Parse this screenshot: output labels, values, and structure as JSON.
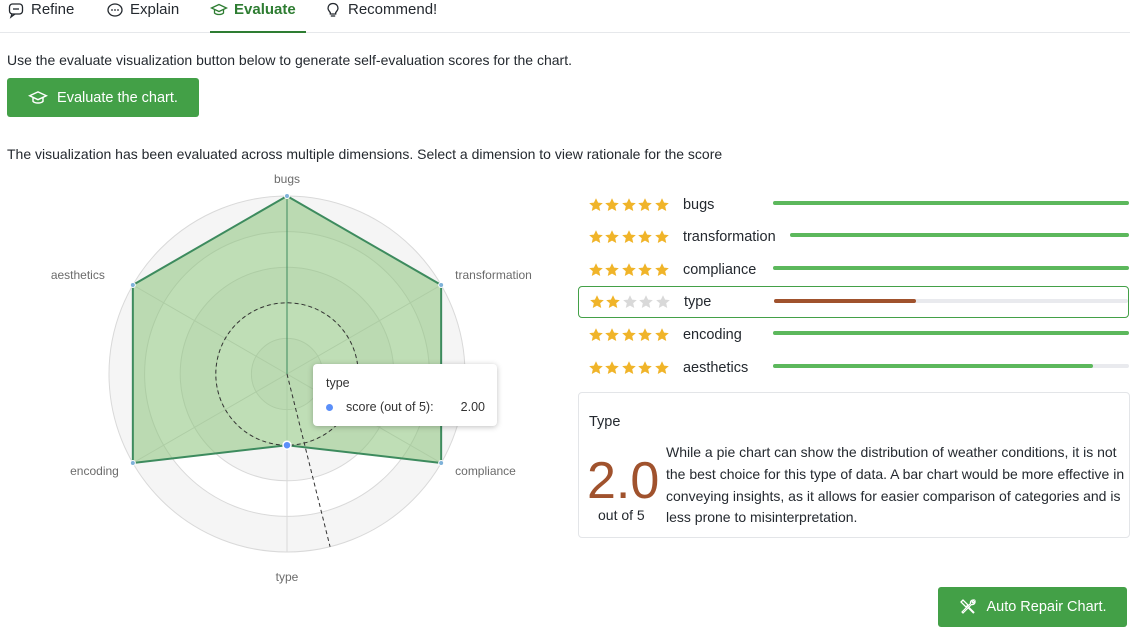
{
  "tabs": [
    {
      "label": "Refine",
      "icon": "chat-bubble-icon"
    },
    {
      "label": "Explain",
      "icon": "chat-dots-icon"
    },
    {
      "label": "Evaluate",
      "icon": "graduation-cap-icon",
      "active": true
    },
    {
      "label": "Recommend!",
      "icon": "lightbulb-icon"
    }
  ],
  "intro_text": "Use the evaluate visualization button below to generate self-evaluation scores for the chart.",
  "evaluate_button": {
    "label": "Evaluate the chart.",
    "icon": "graduation-cap-icon"
  },
  "description": "The visualization has been evaluated across multiple dimensions. Select a dimension to view rationale for the score",
  "chart_data": {
    "type": "radar",
    "categories": [
      "bugs",
      "transformation",
      "compliance",
      "type",
      "encoding",
      "aesthetics"
    ],
    "values": [
      5,
      5,
      5,
      2,
      5,
      5
    ],
    "rlim": [
      0,
      5
    ],
    "grid": true
  },
  "tooltip": {
    "title": "type",
    "key": "score (out of 5):",
    "value": "2.00"
  },
  "scores": [
    {
      "name": "bugs",
      "score": 5,
      "bar": 1.0,
      "color": "#5cb85c"
    },
    {
      "name": "transformation",
      "score": 5,
      "bar": 1.0,
      "color": "#5cb85c"
    },
    {
      "name": "compliance",
      "score": 5,
      "bar": 1.0,
      "color": "#5cb85c"
    },
    {
      "name": "type",
      "score": 2,
      "bar": 0.4,
      "color": "#a0522d",
      "selected": true
    },
    {
      "name": "encoding",
      "score": 5,
      "bar": 1.0,
      "color": "#5cb85c"
    },
    {
      "name": "aesthetics",
      "score": 5,
      "bar": 0.9,
      "color": "#5cb85c"
    }
  ],
  "detail": {
    "title": "Type",
    "score": "2.0",
    "out_of": "out of 5",
    "rationale": "While a pie chart can show the distribution of weather conditions, it is not the best choice for this type of data. A bar chart would be more effective in conveying insights, as it allows for easier comparison of categories and is less prone to misinterpretation."
  },
  "repair_button": {
    "label": "Auto Repair Chart.",
    "icon": "tools-icon"
  },
  "colors": {
    "accent": "#43a047",
    "star": "#f0b429",
    "star_empty": "#d9d9d9",
    "low_score": "#a0522d"
  }
}
